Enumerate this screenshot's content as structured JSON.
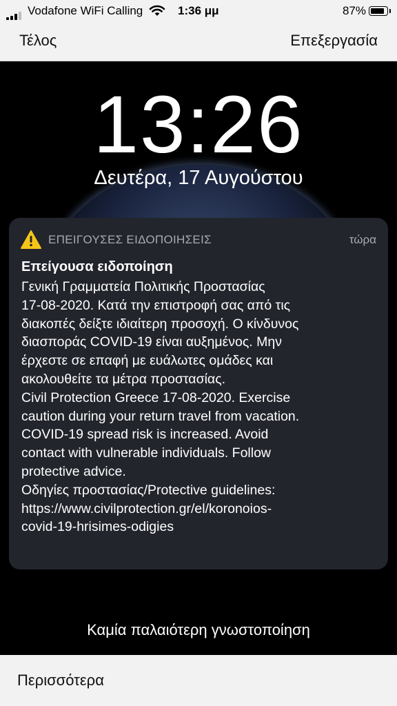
{
  "status_bar": {
    "carrier": "Vodafone WiFi Calling",
    "time": "1:36 μμ",
    "battery_percent": "87%",
    "battery_level": 0.87,
    "signal_bars": 3
  },
  "nav": {
    "done_label": "Τέλος",
    "edit_label": "Επεξεργασία"
  },
  "lock_screen": {
    "time": "13:26",
    "date": "Δευτέρα, 17 Αυγούστου"
  },
  "notification": {
    "icon": "warning-triangle-icon",
    "icon_color": "#f5c518",
    "app_name": "ΕΠΕΙΓΟΥΣΕΣ ΕΙΔΟΠΟΙΗΣΕΙΣ",
    "time_ago": "τώρα",
    "title": "Επείγουσα ειδοποίηση",
    "body_lines": [
      "Γενική Γραμματεία  Πολιτικής Προστασίας",
      "17-08-2020. Κατά την επιστροφή σας από τις",
      "διακοπές δείξτε ιδιαίτερη προσοχή. Ο κίνδυνος",
      "διασποράς COVID-19 είναι αυξημένος. Μην",
      "έρχεστε σε επαφή με ευάλωτες ομάδες και",
      "ακολουθείτε τα μέτρα προστασίας.",
      "Civil Protection Greece 17-08-2020. Exercise",
      "caution during your return travel from vacation.",
      "COVID-19 spread risk is increased. Avoid",
      "contact with vulnerable individuals. Follow",
      "protective advice.",
      "Οδηγίες προστασίας/Protective guidelines:",
      "https://www.civilprotection.gr/el/koronoios-",
      "covid-19-hrisimes-odigies"
    ]
  },
  "no_older_label": "Καμία παλαιότερη γνωστοποίηση",
  "more_label": "Περισσότερα"
}
